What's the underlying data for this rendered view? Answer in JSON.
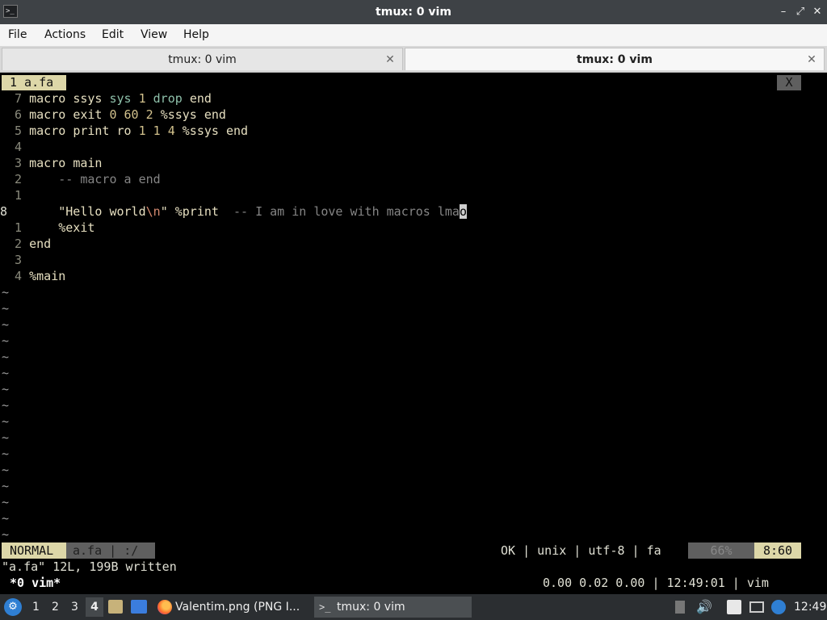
{
  "window": {
    "title": "tmux: 0 vim",
    "app_icon": ">_"
  },
  "menubar": {
    "items": [
      "File",
      "Actions",
      "Edit",
      "View",
      "Help"
    ]
  },
  "tabs": [
    {
      "label": "tmux: 0 vim",
      "active": false
    },
    {
      "label": "tmux: 0 vim",
      "active": true
    }
  ],
  "vim": {
    "tabline": {
      "active_tab": "1 a.fa",
      "close_label": "X"
    },
    "lines": [
      {
        "num": "7",
        "code": "macro ssys sys 1 drop end"
      },
      {
        "num": "6",
        "code": "macro exit 0 60 2 %ssys end"
      },
      {
        "num": "5",
        "code": "macro print ro 1 1 4 %ssys end"
      },
      {
        "num": "4",
        "code": ""
      },
      {
        "num": "3",
        "code": "macro main"
      },
      {
        "num": "2",
        "code": "    -- macro a end"
      },
      {
        "num": "1",
        "code": ""
      },
      {
        "num": "8",
        "code": "    \"Hello world\\n\" %print  -- I am in love with macros lmao"
      },
      {
        "num": "1",
        "code": "    %exit"
      },
      {
        "num": "2",
        "code": "end"
      },
      {
        "num": "3",
        "code": ""
      },
      {
        "num": "4",
        "code": "%main"
      }
    ],
    "tilde": "~",
    "statusline": {
      "mode": "NORMAL",
      "filename": "a.fa | :/",
      "info": "OK | unix | utf-8 | fa",
      "percent": "66%",
      "position": "8:60"
    },
    "message": "\"a.fa\" 12L, 199B written"
  },
  "tmux_status": {
    "left": "*0 vim*",
    "right": "0.00 0.02 0.00 | 12:49:01 | vim"
  },
  "taskbar": {
    "workspaces": [
      "1",
      "2",
      "3",
      "4"
    ],
    "active_workspace": "4",
    "windows": [
      {
        "label": "Valentim.png (PNG I...",
        "icon": "firefox-icon"
      },
      {
        "label": "tmux: 0 vim",
        "icon": "terminal-icon"
      }
    ],
    "clock": "12:49"
  },
  "colors": {
    "vim_mode_bg": "#ddd7a8",
    "tab_active_bg": "#f7f7f7",
    "taskbar_bg": "#2b2e31"
  }
}
